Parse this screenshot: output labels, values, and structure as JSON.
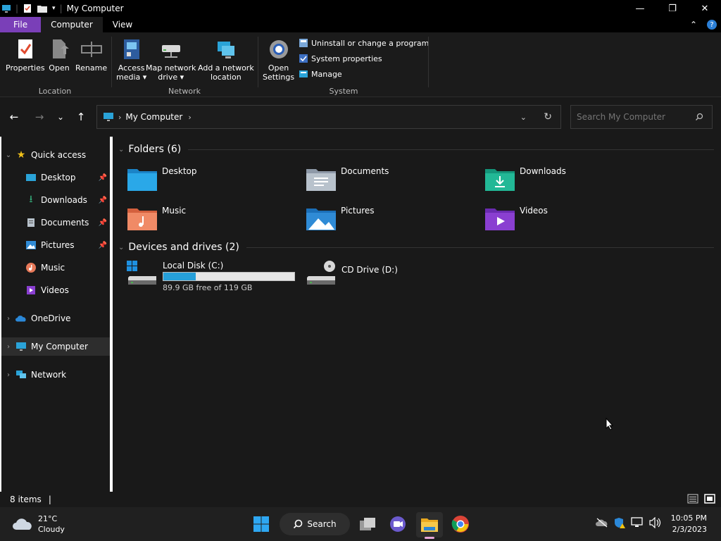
{
  "window": {
    "title": "My Computer",
    "controls": {
      "minimize": "—",
      "maximize": "❐",
      "close": "✕"
    }
  },
  "ribbon": {
    "tabs": [
      {
        "label": "File"
      },
      {
        "label": "Computer"
      },
      {
        "label": "View"
      }
    ],
    "location": {
      "label": "Location",
      "buttons": [
        {
          "label": "Properties"
        },
        {
          "label": "Open"
        },
        {
          "label": "Rename"
        }
      ]
    },
    "network": {
      "label": "Network",
      "access_media": [
        "Access",
        "media ▾"
      ],
      "map_drive": [
        "Map network",
        "drive ▾"
      ],
      "add_location": [
        "Add a network",
        "location"
      ]
    },
    "system": {
      "label": "System",
      "open_settings": [
        "Open",
        "Settings"
      ],
      "items": [
        {
          "label": "Uninstall or change a program"
        },
        {
          "label": "System properties"
        },
        {
          "label": "Manage"
        }
      ]
    }
  },
  "address": {
    "crumb": "My Computer",
    "search_placeholder": "Search My Computer"
  },
  "sidebar": {
    "quick_access": "Quick access",
    "items": [
      {
        "label": "Desktop",
        "pinned": true
      },
      {
        "label": "Downloads",
        "pinned": true
      },
      {
        "label": "Documents",
        "pinned": true
      },
      {
        "label": "Pictures",
        "pinned": true
      },
      {
        "label": "Music",
        "pinned": false
      },
      {
        "label": "Videos",
        "pinned": false
      }
    ],
    "onedrive": "OneDrive",
    "my_computer": "My Computer",
    "network": "Network"
  },
  "main": {
    "folders_header": "Folders (6)",
    "folders": [
      {
        "label": "Desktop",
        "icon": "desktop-folder-icon"
      },
      {
        "label": "Documents",
        "icon": "documents-folder-icon"
      },
      {
        "label": "Downloads",
        "icon": "downloads-folder-icon"
      },
      {
        "label": "Music",
        "icon": "music-folder-icon"
      },
      {
        "label": "Pictures",
        "icon": "pictures-folder-icon"
      },
      {
        "label": "Videos",
        "icon": "videos-folder-icon"
      }
    ],
    "drives_header": "Devices and drives (2)",
    "drives": [
      {
        "label": "Local Disk (C:)",
        "free": "89.9 GB free of 119 GB",
        "used_fraction": 0.245
      },
      {
        "label": "CD Drive (D:)"
      }
    ]
  },
  "status": {
    "items": "8 items"
  },
  "taskbar": {
    "weather": {
      "temp": "21°C",
      "condition": "Cloudy"
    },
    "search_label": "Search",
    "time": "10:05 PM",
    "date": "2/3/2023"
  }
}
